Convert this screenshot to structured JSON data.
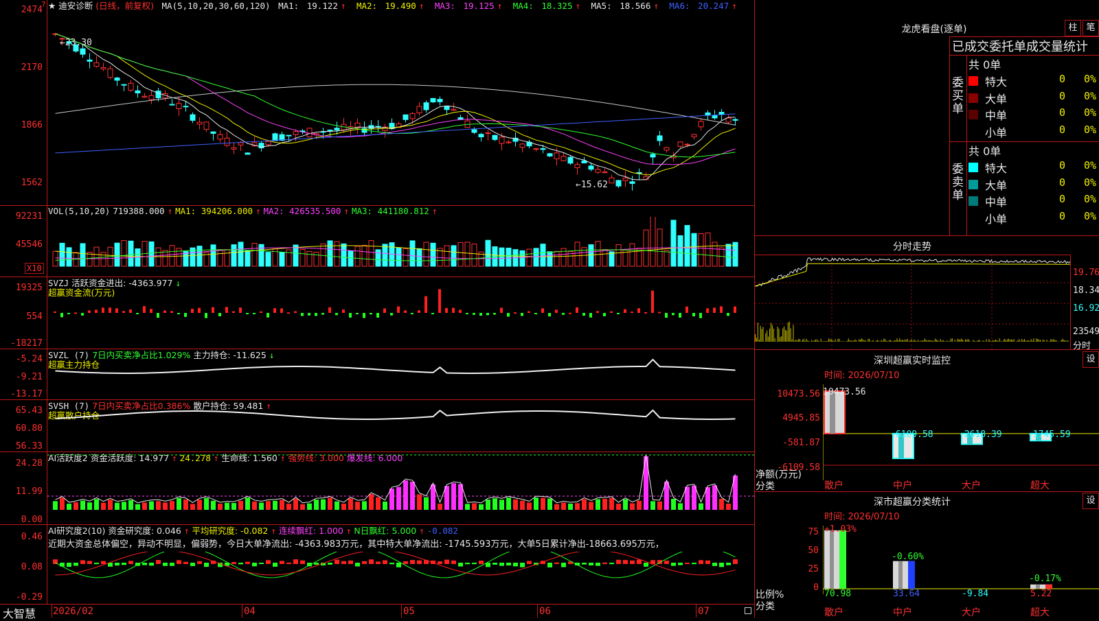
{
  "stock": {
    "star": "★",
    "name": "迪安诊断",
    "period_label": "(日线，前复权)"
  },
  "main_chart": {
    "indicator": "MA(5,10,20,30,60,120)",
    "ma": [
      {
        "label": "MA1:",
        "value": "19.122",
        "arrow": "↑",
        "color": "#e8e8e8"
      },
      {
        "label": "MA2:",
        "value": "19.490",
        "arrow": "↑",
        "color": "#f0f000"
      },
      {
        "label": "MA3:",
        "value": "19.125",
        "arrow": "↑",
        "color": "#ff40ff"
      },
      {
        "label": "MA4:",
        "value": "18.325",
        "arrow": "↑",
        "color": "#30ff30"
      },
      {
        "label": "MA5:",
        "value": "18.566",
        "arrow": "↑",
        "color": "#e8e8e8"
      },
      {
        "label": "MA6:",
        "value": "20.247",
        "arrow": "↑",
        "color": "#4060ff"
      }
    ],
    "y_ticks": [
      "2474",
      "2170",
      "1866",
      "1562"
    ],
    "high_label": "←23.30",
    "low_label": "←15.62"
  },
  "vol_panel": {
    "title": "VOL(5,10,20)",
    "value": "719388.000",
    "arrow": "↑",
    "ma1": "MA1: 394206.000",
    "ma2": "MA2: 426535.500",
    "ma3": "MA3: 441180.812",
    "y_ticks": [
      "92231",
      "45546"
    ],
    "unit": "X10"
  },
  "svzj_panel": {
    "title": "SVZJ",
    "label": "活跃资金进出: -4363.977",
    "arrow": "↓",
    "sub": "超赢资金流(万元)",
    "y_ticks": [
      "19325",
      "554",
      "-18217"
    ]
  },
  "svzl_panel": {
    "title": "SVZL (7)",
    "label1": "7日内买卖净占比1.029%",
    "label2": "主力持仓: -11.625",
    "arrow": "↓",
    "sub": "超赢主力持仓",
    "y_ticks": [
      "-5.24",
      "-9.21",
      "-13.17"
    ]
  },
  "svsh_panel": {
    "title": "SVSH (7)",
    "label1": "7日内买卖净占比0.386%",
    "label2": "散户持仓: 59.481",
    "arrow": "↑",
    "sub": "超赢散户持仓",
    "y_ticks": [
      "65.43",
      "60.80",
      "56.33"
    ]
  },
  "ai_active_panel": {
    "title": "AI活跃度2",
    "label1": "资金活跃度: 14.977",
    "v2": "24.278",
    "v3": "生命线: 1.560",
    "v4": "强势线: 3.000",
    "v5": "爆发线: 6.000",
    "y_ticks": [
      "24.28",
      "11.99",
      "0.00"
    ]
  },
  "ai_research_panel": {
    "title": "AI研究度2(10)",
    "label1": "资金研究度: 0.046",
    "v2": "平均研究度: -0.082",
    "v3": "连续飘红: 1.000",
    "v4": "N日飘红: 5.000",
    "v5": "-0.082",
    "comment": "近期大资金总体偏空，异动不明显，偏弱势，今日大单净流出: -4363.983万元，其中特大单净流出: -1745.593万元，大单5日累计净出-18663.695万元，",
    "y_ticks": [
      "0.46",
      "0.08",
      "-0.29"
    ]
  },
  "x_axis": {
    "labels": [
      "2026/02",
      "04",
      "05",
      "06",
      "07"
    ]
  },
  "brand": "大智慧",
  "dragon_tiger": {
    "title": "龙虎看盘(逐单)",
    "btn_bar": "柱",
    "btn_stroke": "笔",
    "subtitle": "已成交委托单成交量统计",
    "buy": {
      "side": "委买单",
      "count": "共 0单",
      "rows": [
        {
          "label": "特大",
          "value": "0",
          "pct": "0%",
          "color": "#ff0000"
        },
        {
          "label": "大单",
          "value": "0",
          "pct": "0%",
          "color": "#8a0000"
        },
        {
          "label": "中单",
          "value": "0",
          "pct": "0%",
          "color": "#5a0000"
        },
        {
          "label": "小单",
          "value": "0",
          "pct": "0%",
          "color": "#000000"
        }
      ]
    },
    "sell": {
      "side": "委卖单",
      "count": "共 0单",
      "rows": [
        {
          "label": "特大",
          "value": "0",
          "pct": "0%",
          "color": "#00ffff"
        },
        {
          "label": "大单",
          "value": "0",
          "pct": "0%",
          "color": "#009a9a"
        },
        {
          "label": "中单",
          "value": "0",
          "pct": "0%",
          "color": "#007a7a"
        },
        {
          "label": "小单",
          "value": "0",
          "pct": "0%",
          "color": "#000000"
        }
      ]
    }
  },
  "intraday": {
    "title": "分时走势",
    "y_ticks": [
      "19.76",
      "18.34",
      "16.92"
    ],
    "vol_label": "23549",
    "time_label": "分时"
  },
  "sz_monitor": {
    "title": "深圳超赢实时监控",
    "btn": "设",
    "date": "时间: 2026/07/10",
    "y_ticks": [
      "10473.56",
      "4945.85",
      "-581.87",
      "-6109.58"
    ],
    "ylabel": "净额(万元)",
    "xlabel": "分类",
    "bars": [
      {
        "label": "散户",
        "value": "10473.56"
      },
      {
        "label": "中户",
        "value": "-6109.58"
      },
      {
        "label": "大户",
        "value": "-2618.39"
      },
      {
        "label": "超大",
        "value": "-1745.59"
      }
    ]
  },
  "sz_classify": {
    "title": "深市超赢分类统计",
    "btn": "设",
    "date": "时间: 2026/07/10",
    "y_ticks": [
      "75",
      "50",
      "25",
      "0"
    ],
    "ylabel": "比例%",
    "xlabel": "分类",
    "top_labels": [
      "+1.03%",
      "-0.60%",
      "-0.17%"
    ],
    "bars": [
      {
        "label": "散户",
        "value": "70.98"
      },
      {
        "label": "中户",
        "value": "33.64"
      },
      {
        "label": "大户",
        "value": "-9.84"
      },
      {
        "label": "超大",
        "value": "5.22"
      }
    ]
  },
  "chart_data": [
    {
      "type": "candlestick",
      "title": "迪安诊断",
      "ma_values": {
        "MA1": 19.122,
        "MA2": 19.49,
        "MA3": 19.125,
        "MA4": 18.325,
        "MA5": 18.566,
        "MA6": 20.247
      },
      "high": 23.3,
      "low": 15.62,
      "y_ticks": [
        "2474",
        "2170",
        "1866",
        "1562"
      ]
    },
    {
      "type": "bar",
      "title": "VOL(5,10,20)",
      "value": 719388.0,
      "ma": [
        394206.0,
        426535.5,
        441180.812
      ]
    },
    {
      "type": "bar",
      "title": "深圳超赢实时监控",
      "categories": [
        "散户",
        "中户",
        "大户",
        "超大"
      ],
      "values": [
        10473.56,
        -6109.58,
        -2618.39,
        -1745.59
      ],
      "ylabel": "净额(万元)"
    },
    {
      "type": "bar",
      "title": "深市超赢分类统计",
      "categories": [
        "散户",
        "中户",
        "大户",
        "超大"
      ],
      "values": [
        70.98,
        33.64,
        -9.84,
        5.22
      ],
      "change": [
        "+1.03%",
        "-0.60%",
        "",
        "-0.17%"
      ],
      "ylabel": "比例%",
      "ylim": [
        0,
        75
      ]
    }
  ]
}
